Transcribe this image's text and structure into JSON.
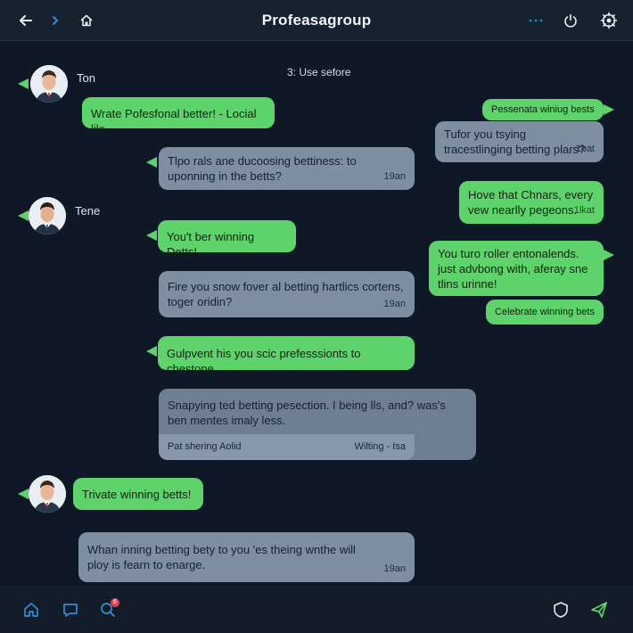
{
  "header": {
    "title": "Profeasagroup",
    "icons": [
      "back-arrow-icon",
      "forward-chevron-icon",
      "home-icon",
      "more-dots-icon",
      "power-icon",
      "settings-gear-icon"
    ]
  },
  "system_note": "3: Use sefore",
  "contacts": [
    {
      "name": "Ton"
    },
    {
      "name": "Tene"
    },
    {
      "name": ""
    }
  ],
  "messages": [
    {
      "text": "Wrate Pofesfonal better! - Locial lile.",
      "time": ""
    },
    {
      "text": "Pessenata winiug bests",
      "time": ""
    },
    {
      "text": "Tufor you tsying tracestlinging betting plars?",
      "time": "1bat"
    },
    {
      "text": "Tlpo rals ane ducoosing bettiness: to uponning in the betts?",
      "time": "19an"
    },
    {
      "text": "Hove that Chnars, every vew nearlly pegeons.",
      "time": "1lkat"
    },
    {
      "text": "You't ber winning Detts!",
      "time": ""
    },
    {
      "text": "You turo roller entonalends. just advbong with, aferay sne tlins urinne!",
      "time": ""
    },
    {
      "text": "Fire you snow fover al betting hartlics cortens, toger oridin?",
      "time": "19an"
    },
    {
      "text": "Celebrate winning bets",
      "time": ""
    },
    {
      "text": "Gulpvent his you scic prefesssionts to chestone.",
      "time": ""
    },
    {
      "text": "Snapying ted betting pesection. I being lls, and? was's ben mentes imaly less.",
      "time": ""
    },
    {
      "text": "Pat shering Aolid",
      "time": "Wilting - Isa"
    },
    {
      "text": "Trivate winning betts!",
      "time": ""
    },
    {
      "text": "Whan inning betting bety to you 'es theing wnthe will ploy is fearn to enarge.",
      "time": "19an"
    }
  ],
  "bottom_bar": {
    "icons": [
      "home-icon",
      "chat-icon",
      "search-icon",
      "shield-icon",
      "send-icon"
    ],
    "notification_count": "6"
  },
  "colors": {
    "background": "#0f1826",
    "bubble_green": "#5fd36b",
    "bubble_gray": "#7e8fa2",
    "accent_blue": "#2d8fd8"
  }
}
